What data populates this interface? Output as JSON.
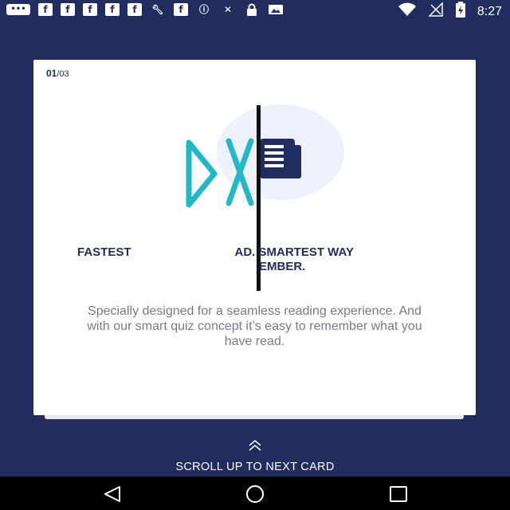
{
  "status_bar": {
    "time": "8:27",
    "left_icons": [
      "message-icon",
      "facebook-icon",
      "facebook-icon",
      "facebook-icon",
      "facebook-icon",
      "facebook-icon",
      "wrench-icon",
      "facebook-icon",
      "info-icon",
      "no-sim-icon",
      "lock-icon",
      "image-icon"
    ],
    "right_icons": [
      "wifi-icon",
      "signal-icon",
      "battery-icon"
    ]
  },
  "card": {
    "counter_current": "01",
    "counter_total": "/03",
    "headline_left": "FASTEST",
    "headline_right": "AD. SMARTEST WAY",
    "headline_line2": "EMBER.",
    "body": "Specially designed for a seamless reading experience. And with our smart quiz concept it’s easy to remember what you have read."
  },
  "scroll_hint": {
    "label": "SCROLL UP TO NEXT CARD"
  },
  "colors": {
    "background": "#232c5e",
    "card": "#ffffff",
    "accent": "#232c5e",
    "logo_teal": "#22b8c8"
  }
}
